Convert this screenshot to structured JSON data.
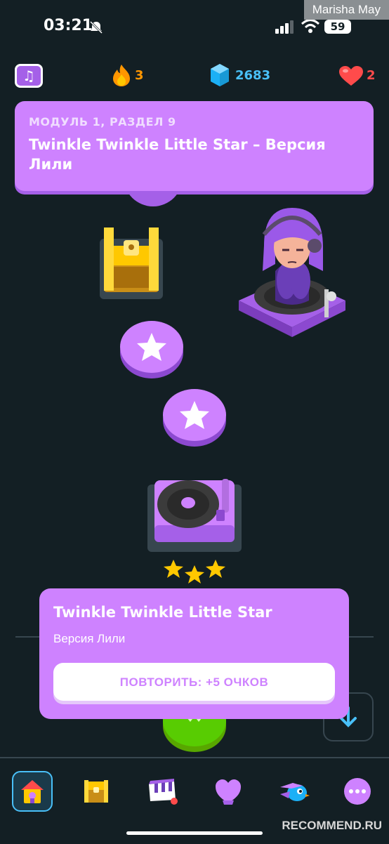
{
  "status_bar": {
    "time": "03:21",
    "battery": "59",
    "watermark_name": "Marisha May"
  },
  "stats": {
    "streak": "3",
    "gems": "2683",
    "hearts": "2"
  },
  "banner": {
    "subtitle": "МОДУЛЬ 1, РАЗДЕЛ 9",
    "title": "Twinkle Twinkle Little Star – Версия Лили"
  },
  "popup": {
    "title": "Twinkle Twinkle Little Star",
    "subtitle": "Версия Лили",
    "button_label": "ПОВТОРИТЬ: +5 ОЧКОВ"
  },
  "colors": {
    "background": "#131f24",
    "accent": "#ce82ff",
    "streak": "#ff9600",
    "gems": "#49c0f8",
    "hearts": "#ff4b4b",
    "green": "#58cc02",
    "gold": "#ffc800"
  },
  "icons": {
    "music": "music-note-icon",
    "streak": "flame-icon",
    "gems": "gem-icon",
    "hearts": "heart-icon",
    "nav": [
      "home-icon",
      "chest-icon",
      "piano-icon",
      "league-shield-icon",
      "bird-icon",
      "more-icon"
    ]
  },
  "watermark": "RECOMMEND.RU"
}
